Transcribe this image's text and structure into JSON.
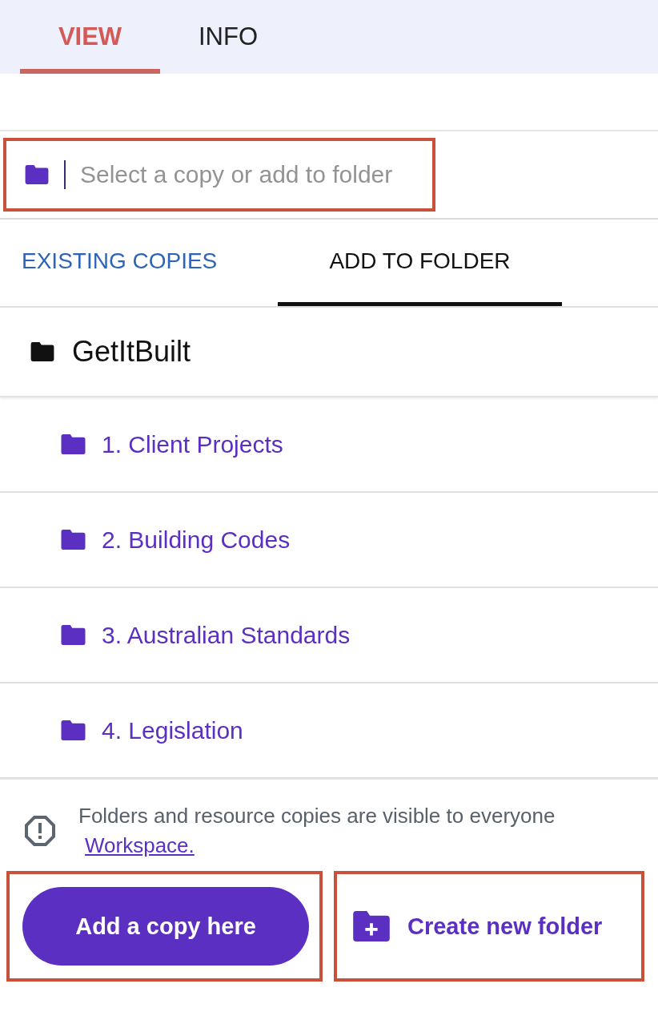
{
  "tabs": [
    {
      "label": "VIEW",
      "selected": true
    },
    {
      "label": "INFO",
      "selected": false
    }
  ],
  "search": {
    "placeholder": "Select a copy or add to folder",
    "highlighted": true
  },
  "subtabs": [
    {
      "label": "EXISTING COPIES",
      "selected": false
    },
    {
      "label": "ADD TO FOLDER",
      "selected": true
    }
  ],
  "folder_tree": {
    "label": "GetItBuilt",
    "children": [
      {
        "label": "1. Client Projects"
      },
      {
        "label": "2. Building Codes"
      },
      {
        "label": "3. Australian Standards"
      },
      {
        "label": "4. Legislation"
      }
    ]
  },
  "notice": {
    "text": "Folders and resource copies are visible to everyone",
    "link": "Workspace."
  },
  "buttons": [
    {
      "kind": "primary",
      "label": "Add a copy here",
      "highlighted": true
    },
    {
      "kind": "icon-link",
      "label": "Create new folder",
      "highlighted": true
    }
  ]
}
